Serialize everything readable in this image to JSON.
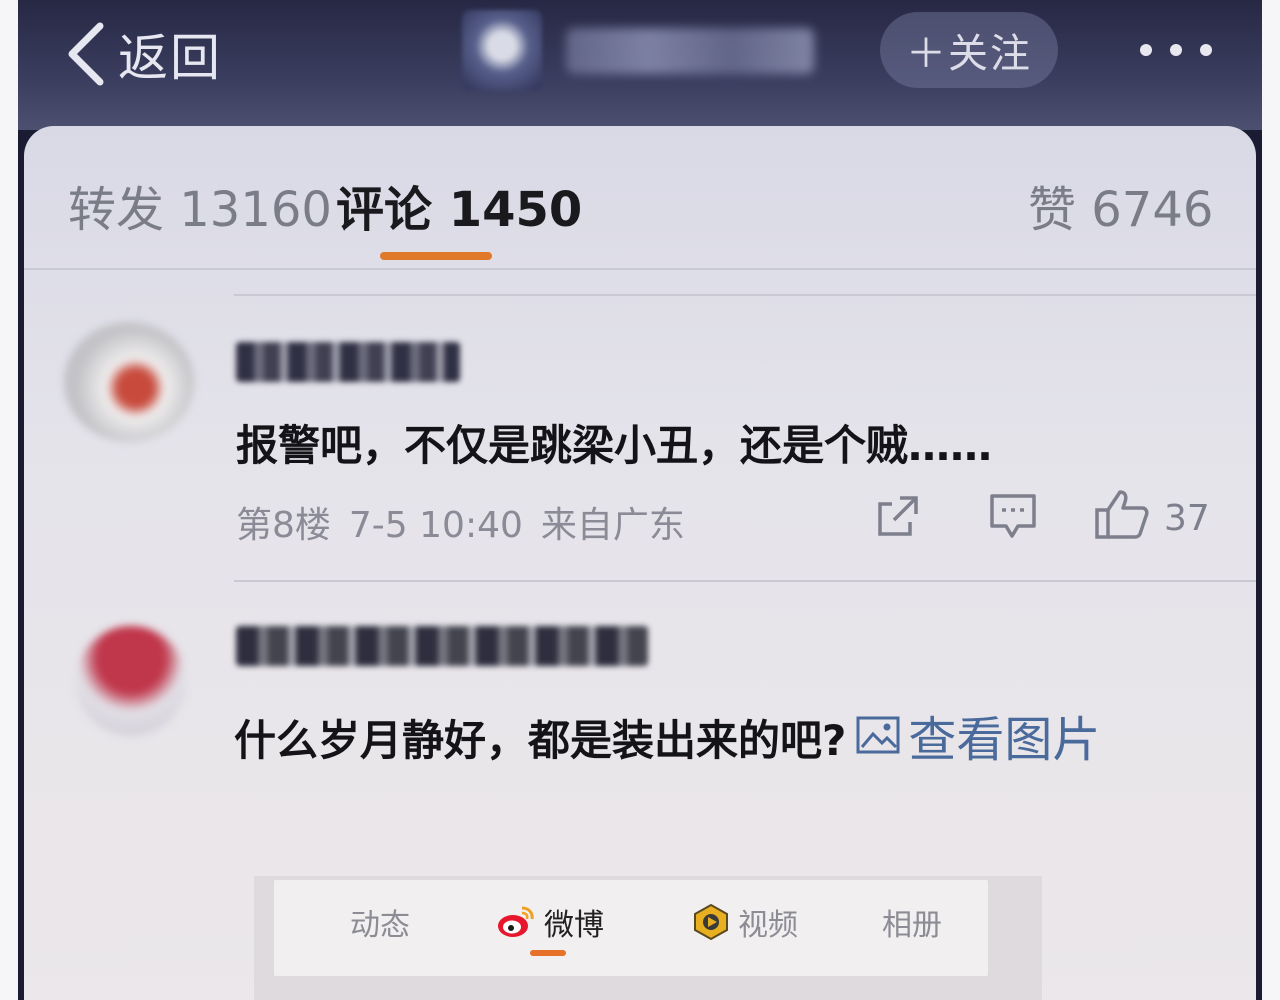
{
  "header": {
    "back_label": "返回",
    "follow_label": "＋关注",
    "more_icon": "ellipsis-icon"
  },
  "tabs": {
    "repost": "转发 13160",
    "comments": "评论 1450",
    "likes": "赞 6746",
    "active": "comments",
    "accent_color": "#e07a2a"
  },
  "comments": [
    {
      "text": "报警吧，不仅是跳梁小丑，还是个贼……",
      "floor": "第8楼",
      "time": "7-5 10:40",
      "location": "来自广东",
      "like_count": "37"
    },
    {
      "text": "什么岁月静好，都是装出来的吧?",
      "view_image_label": "查看图片",
      "link_color": "#4a6a9c"
    }
  ],
  "bottom_tabs": {
    "items": [
      "动态",
      "微博",
      "视频",
      "相册"
    ],
    "active": "微博"
  }
}
